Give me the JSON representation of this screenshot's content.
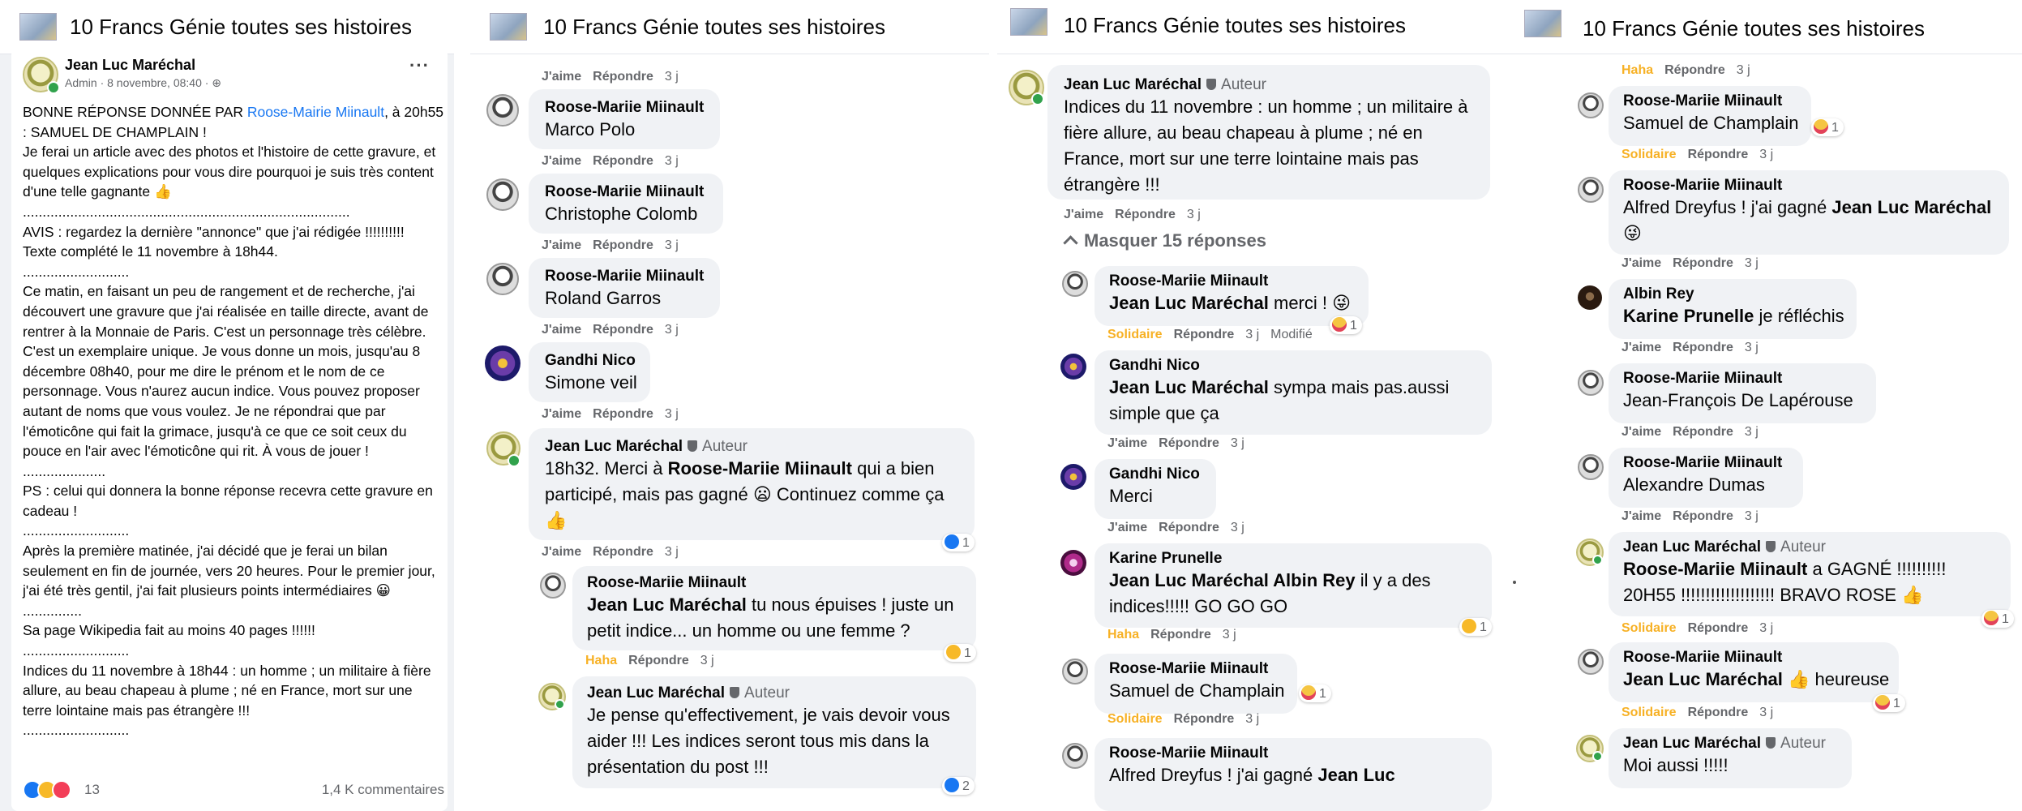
{
  "page_title": "10 Francs Génie toutes ses histoires",
  "actions": {
    "like": "J'aime",
    "reply": "Répondre",
    "haha": "Haha",
    "solidaire": "Solidaire",
    "time": "3 j",
    "modified": "Modifié"
  },
  "author_badge": "Auteur",
  "post": {
    "author": "Jean Luc Maréchal",
    "meta": "Admin · 8 novembre, 08:40 · ⊕",
    "more": "···",
    "line1_a": "BONNE RÉPONSE DONNÉE PAR ",
    "line1_link": "Roose-Mairie Miinault",
    "line1_b": ", à 20h55 : SAMUEL DE CHAMPLAIN !",
    "p1": "Je ferai un article avec des photos et l'histoire de cette gravure, et quelques explications pour vous dire pourquoi je suis très content d'une telle gagnante 👍",
    "sep1": "...................................................................................",
    "p2": "AVIS : regardez la dernière \"annonce\" que j'ai rédigée !!!!!!!!!!\nTexte complété le 11 novembre à 18h44.",
    "sep2": "...........................",
    "p3": "Ce matin, en faisant un peu de rangement et de recherche, j'ai découvert une gravure que j'ai réalisée en taille directe, avant de rentrer à la Monnaie de Paris. C'est un personnage très célèbre. C'est un exemplaire unique. Je vous donne un mois, jusqu'au 8 décembre 08h40, pour me dire le prénom et le nom de ce personnage. Vous n'aurez aucun indice. Vous pouvez proposer autant de noms que vous voulez. Je ne répondrai que par l'émoticône qui fait la grimace, jusqu'à ce que ce soit ceux du pouce en l'air avec l'émoticône qui rit. À vous de jouer !",
    "sep3": ".....................",
    "p4": "PS : celui qui donnera la bonne réponse recevra cette gravure en cadeau !",
    "sep4": "...........................",
    "p5": "Après la première matinée, j'ai décidé que je ferai un bilan seulement en fin de journée, vers 20 heures. Pour le premier jour, j'ai été très gentil, j'ai fait plusieurs points intermédiaires 😀",
    "sep5": "...............",
    "p6": "Sa page Wikipedia fait au moins 40 pages !!!!!!",
    "sep6": "...........................",
    "p7": "Indices du 11 novembre à 18h44 : un homme ; un militaire à fière allure, au beau chapeau à plume ; né en France, mort sur une terre lointaine mais pas étrangère !!!",
    "sep7": "...........................",
    "reaction_count": "13",
    "comment_count": "1,4 K commentaires"
  },
  "panel2": {
    "c1": {
      "name": "Roose-Mariie Miinault",
      "text": "Marco Polo"
    },
    "c2": {
      "name": "Roose-Mariie Miinault",
      "text": "Christophe Colomb"
    },
    "c3": {
      "name": "Roose-Mariie Miinault",
      "text": "Roland Garros"
    },
    "c4": {
      "name": "Gandhi Nico",
      "text": "Simone veil"
    },
    "c5": {
      "name": "Jean Luc Maréchal",
      "t1": "18h32. Merci à ",
      "t_bold": "Roose-Mariie Miinault",
      "t2": " qui a bien participé, mais pas gagné 😦 Continuez comme ça 👍",
      "rc": "1"
    },
    "c6": {
      "name": "Roose-Mariie Miinault",
      "t_bold": "Jean Luc Maréchal",
      "t2": " tu nous épuises ! juste un petit indice... un homme ou une femme ?",
      "rc": "1"
    },
    "c7": {
      "name": "Jean Luc Maréchal",
      "text": "Je pense qu'effectivement, je vais devoir vous aider !!! Les indices seront tous mis dans la présentation du post !!!",
      "rc": "2"
    }
  },
  "panel3": {
    "c1": {
      "name": "Jean Luc Maréchal",
      "text": "Indices du 11 novembre : un homme ; un militaire à fière allure, au beau chapeau à plume ; né en France, mort sur une terre lointaine mais pas étrangère !!!"
    },
    "hide": "Masquer 15 réponses",
    "c2": {
      "name": "Roose-Mariie Miinault",
      "t_bold": "Jean Luc Maréchal",
      "t2": " merci ! 😜",
      "rc": "1"
    },
    "c3": {
      "name": "Gandhi Nico",
      "t_bold": "Jean Luc Maréchal",
      "t2": " sympa mais pas.aussi simple que ça"
    },
    "c4": {
      "name": "Gandhi Nico",
      "text": "Merci"
    },
    "c5": {
      "name": "Karine Prunelle",
      "t_bold": "Jean Luc Maréchal Albin Rey",
      "t2": " il y a des indices!!!!! GO GO GO",
      "rc": "1"
    },
    "c6": {
      "name": "Roose-Mariie Miinault",
      "text": "Samuel de Champlain",
      "rc": "1"
    },
    "c7": {
      "name": "Roose-Mariie Miinault",
      "t1": "Alfred Dreyfus ! j'ai gagné ",
      "t_bold": "Jean Luc"
    }
  },
  "panel4": {
    "c1": {
      "name": "Roose-Mariie Miinault",
      "text": "Samuel de Champlain",
      "rc": "1"
    },
    "c2": {
      "name": "Roose-Mariie Miinault",
      "t1": "Alfred Dreyfus ! j'ai gagné ",
      "t_bold": "Jean Luc Maréchal",
      "t2": " 😜"
    },
    "c3": {
      "name": "Albin Rey",
      "t_bold": "Karine Prunelle",
      "t2": " je réfléchis"
    },
    "c4": {
      "name": "Roose-Mariie Miinault",
      "text": "Jean-François De Lapérouse"
    },
    "c5": {
      "name": "Roose-Mariie Miinault",
      "text": "Alexandre Dumas"
    },
    "c6": {
      "name": "Jean Luc Maréchal",
      "t_bold": "Roose-Mariie Miinault",
      "t2": " a GAGNÉ !!!!!!!!!! 20H55 !!!!!!!!!!!!!!!!!!! BRAVO ROSE 👍",
      "rc": "1"
    },
    "c7": {
      "name": "Roose-Mariie Miinault",
      "t_bold": "Jean Luc Maréchal",
      "t2": " 👍 heureuse",
      "rc": "1"
    },
    "c8": {
      "name": "Jean Luc Maréchal",
      "text": "Moi aussi !!!!!"
    }
  }
}
